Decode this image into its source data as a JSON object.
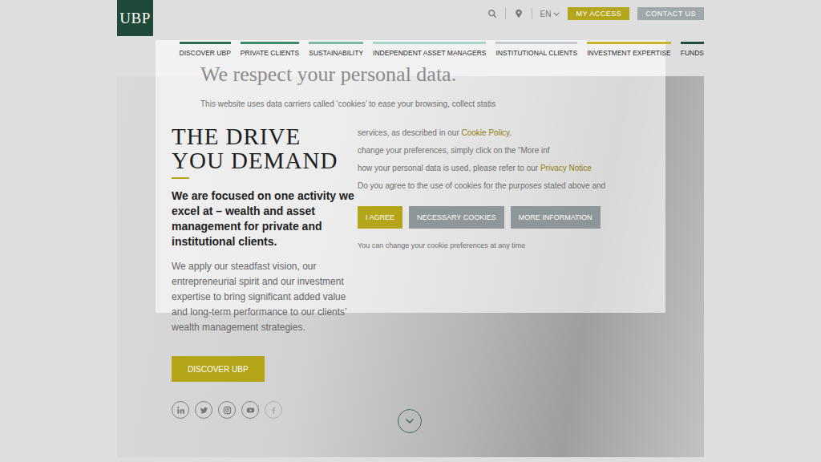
{
  "header": {
    "logo": "UBP",
    "language": "EN",
    "buttons": [
      {
        "label": "MY ACCESS",
        "color": "#b5a51b"
      },
      {
        "label": "CONTACT US",
        "color": "#9ea8ab"
      }
    ]
  },
  "nav": [
    {
      "label": "DISCOVER UBP",
      "color": "#2f6b4f"
    },
    {
      "label": "PRIVATE CLIENTS",
      "color": "#3d8c6e"
    },
    {
      "label": "SUSTAINABILITY",
      "color": "#7fb8a3"
    },
    {
      "label": "INDEPENDENT ASSET MANAGERS",
      "color": "#a8d3c8"
    },
    {
      "label": "INSTITUTIONAL CLIENTS",
      "color": "#c4c9cc"
    },
    {
      "label": "INVESTMENT EXPERTISE",
      "color": "#c8b62a"
    },
    {
      "label": "FUNDS",
      "color": "#1f4d3a"
    }
  ],
  "cookie_banner": {
    "title": "We respect your personal data.",
    "intro": "This website uses data carriers called ‘cookies’ to ease your browsing, collect statis",
    "lines": [
      [
        {
          "text": "services, as described in our ",
          "link": false
        },
        {
          "text": "Cookie Policy",
          "link": true
        },
        {
          "text": ".",
          "link": false
        }
      ],
      [
        {
          "text": "change your preferences, simply click on the “More inf",
          "link": false
        }
      ],
      [
        {
          "text": "how your personal data is used, please refer to our ",
          "link": false
        },
        {
          "text": "Privacy Notice",
          "link": true
        }
      ],
      [
        {
          "text": "Do you agree to the use of cookies for the purposes stated above and",
          "link": false
        }
      ]
    ],
    "buttons": [
      {
        "label": "I AGREE",
        "kind": "primary"
      },
      {
        "label": "NECESSARY COOKIES",
        "kind": "secondary"
      },
      {
        "label": "MORE INFORMATION",
        "kind": "secondary"
      }
    ],
    "footer": "You can change your cookie preferences at any time"
  },
  "hero": {
    "title_lines": [
      "THE DRIVE",
      "YOU DEMAND"
    ],
    "lead": "We are focused on one activity we excel at – wealth and asset management for private and institutional clients.",
    "body": "We apply our steadfast vision, our entrepreneurial spirit and our investment expertise to bring significant added value and long-term performance to our clients’ wealth management strategies.",
    "button": "DISCOVER UBP"
  }
}
